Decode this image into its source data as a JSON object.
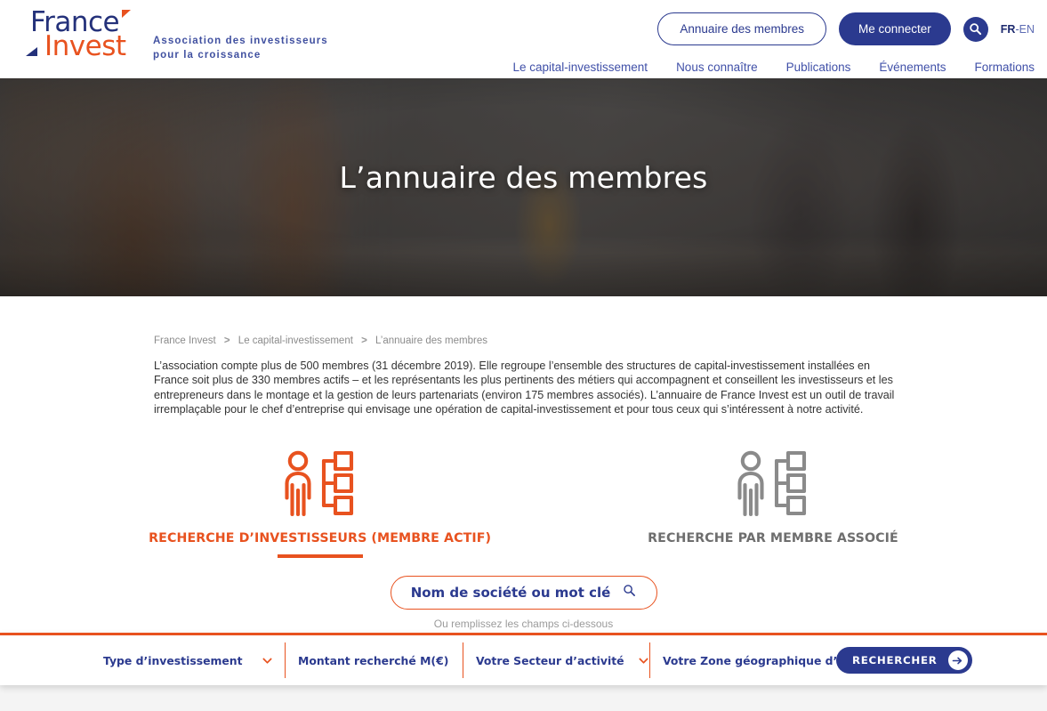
{
  "header": {
    "logo": {
      "word1": "France",
      "word2": "Invest",
      "tagline": "Association des investisseurs\npour la croissance"
    },
    "directory_button": "Annuaire des membres",
    "login_button": "Me connecter",
    "search_icon": "search-icon",
    "lang": {
      "fr": "FR",
      "separator": "-",
      "en": "EN"
    },
    "nav": [
      {
        "label": "Le capital-investissement"
      },
      {
        "label": "Nous connaître"
      },
      {
        "label": "Publications"
      },
      {
        "label": "Événements"
      },
      {
        "label": "Formations"
      }
    ]
  },
  "hero": {
    "title": "L’annuaire des membres"
  },
  "breadcrumb": [
    {
      "label": "France Invest"
    },
    {
      "label": "Le capital-investissement"
    },
    {
      "label": "L’annuaire des membres"
    }
  ],
  "breadcrumb_separator": ">",
  "intro": {
    "text": "L’association compte plus de 500 membres (31 décembre 2019). Elle regroupe l’ensemble des structures de capital-investissement installées en France soit plus de 330 membres actifs – et les représentants les plus pertinents des métiers qui accompagnent et conseillent les investisseurs et les entrepreneurs dans le montage et la gestion de leurs partenariats (environ 175 membres associés). L’annuaire de France Invest est un outil de travail irremplaçable pour le chef d’entreprise qui envisage une opération de capital-investissement et pour tous ceux qui s’intéressent à notre activité."
  },
  "tabs": [
    {
      "label": "RECHERCHE D’INVESTISSEURS (MEMBRE ACTIF)",
      "icon": "person-org-chart-icon",
      "active": true
    },
    {
      "label": "RECHERCHE PAR MEMBRE ASSOCIÉ",
      "icon": "person-org-chart-icon",
      "active": false
    }
  ],
  "keyword_search": {
    "placeholder": "Nom de société ou mot clé",
    "icon": "magnifier-icon",
    "hint": "Ou remplissez les champs ci-dessous"
  },
  "filters": [
    {
      "label": "Type d’investissement",
      "has_chevron": true
    },
    {
      "label": "Montant recherché M(€)",
      "has_chevron": false
    },
    {
      "label": "Votre Secteur d’activité",
      "has_chevron": true
    },
    {
      "label": "Votre Zone géographique d’activité",
      "has_chevron": true
    }
  ],
  "submit_button": {
    "label": "RECHERCHER",
    "icon": "arrow-right-icon"
  },
  "colors": {
    "brand_blue": "#2b3a8f",
    "brand_orange": "#e8521f",
    "nav_blue": "#4050a8",
    "muted_grey": "#6e6e6e",
    "hint_grey": "#9b9b9b"
  }
}
